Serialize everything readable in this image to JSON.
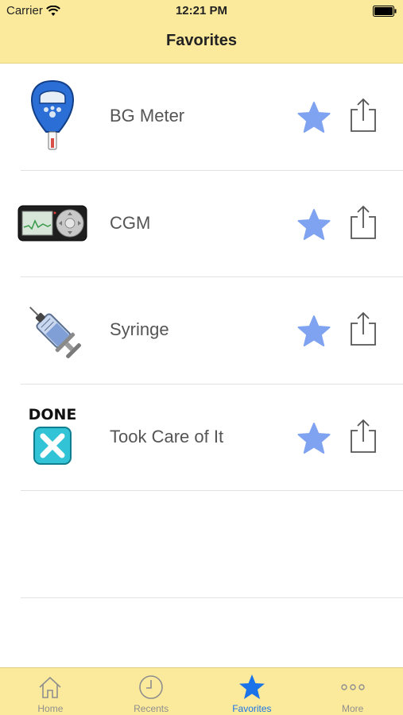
{
  "status_bar": {
    "carrier": "Carrier",
    "time": "12:21 PM"
  },
  "nav": {
    "title": "Favorites"
  },
  "favorites": [
    {
      "label": "BG Meter",
      "icon": "bg-meter-icon"
    },
    {
      "label": "CGM",
      "icon": "cgm-icon"
    },
    {
      "label": "Syringe",
      "icon": "syringe-icon"
    },
    {
      "label": "Took Care of It",
      "icon": "done-icon",
      "icon_text": "DONE"
    }
  ],
  "tabs": [
    {
      "label": "Home",
      "icon": "home-icon",
      "active": false
    },
    {
      "label": "Recents",
      "icon": "clock-icon",
      "active": false
    },
    {
      "label": "Favorites",
      "icon": "star-icon",
      "active": true
    },
    {
      "label": "More",
      "icon": "more-icon",
      "active": false
    }
  ],
  "colors": {
    "bar": "#fcea9c",
    "star": "#7fa3f0",
    "active_tab": "#1a73e8"
  }
}
